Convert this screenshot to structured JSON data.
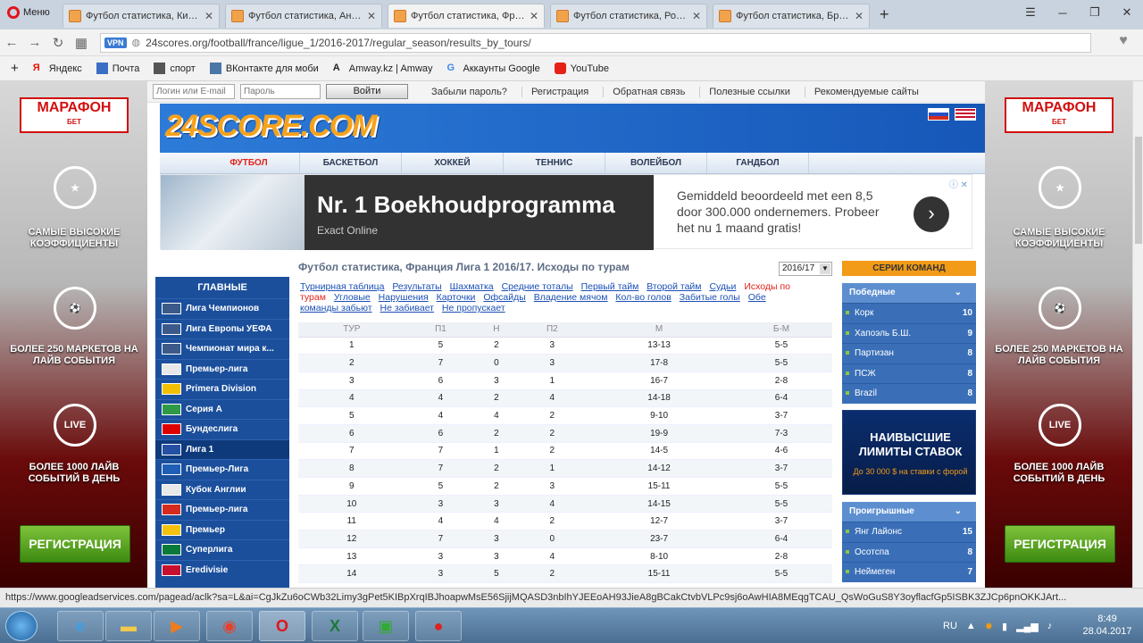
{
  "browser": {
    "menu_label": "Меню",
    "tabs": [
      {
        "title": "Футбол статистика, Китай"
      },
      {
        "title": "Футбол статистика, Англи"
      },
      {
        "title": "Футбол статистика, Франц"
      },
      {
        "title": "Футбол статистика, Росси"
      },
      {
        "title": "Футбол статистика, Бразі"
      }
    ],
    "active_tab": 2,
    "vpn": "VPN",
    "url": "24scores.org/football/france/ligue_1/2016-2017/regular_season/results_by_tours/",
    "bookmarks": [
      {
        "label": "Яндекс",
        "icon": "yandex-icon",
        "color": "#e61400"
      },
      {
        "label": "Почта",
        "icon": "mail-icon",
        "color": "#3b6fc6"
      },
      {
        "label": "спорт",
        "icon": "folder-icon",
        "color": "#444"
      },
      {
        "label": "ВКонтакте для моби",
        "icon": "vk-icon",
        "color": "#4a76a8"
      },
      {
        "label": "Amway.kz | Amway",
        "icon": "amway-icon",
        "color": "#222"
      },
      {
        "label": "Аккаунты Google",
        "icon": "google-icon",
        "color": "#4285f4"
      },
      {
        "label": "YouTube",
        "icon": "youtube-icon",
        "color": "#e62117"
      }
    ]
  },
  "side_ads": {
    "logo": "МАРАФОН",
    "logo_sub": "БЕТ",
    "item1": "САМЫЕ ВЫСОКИЕ КОЭФФИЦИЕНТЫ",
    "item2": "БОЛЕЕ 250 МАРКЕТОВ НА ЛАЙВ СОБЫТИЯ",
    "item3": "БОЛЕЕ 1000 ЛАЙВ СОБЫТИЙ В ДЕНЬ",
    "live": "LIVE",
    "register": "РЕГИСТРАЦИЯ"
  },
  "login": {
    "login_placeholder": "Логин или E-mail",
    "password_placeholder": "Пароль",
    "button": "Войти",
    "links": [
      "Забыли пароль?",
      "Регистрация",
      "Обратная связь",
      "Полезные ссылки",
      "Рекомендуемые сайты"
    ]
  },
  "site": {
    "logo": "24SCORE.COM"
  },
  "sports": [
    "ФУТБОЛ",
    "БАСКЕТБОЛ",
    "ХОККЕЙ",
    "ТЕННИС",
    "ВОЛЕЙБОЛ",
    "ГАНДБОЛ"
  ],
  "ad": {
    "title": "Nr. 1 Boekhoudprogramma",
    "sub": "Exact Online",
    "text": "Gemiddeld beoordeeld met een 8,5 door 300.000 ondernemers. Probeer het nu 1 maand gratis!"
  },
  "left_menu": {
    "head": "ГЛАВНЫЕ",
    "items": [
      {
        "label": "Лига Чемпионов",
        "flag": "#3b5a8a"
      },
      {
        "label": "Лига Европы УЕФА",
        "flag": "#3b5a8a"
      },
      {
        "label": "Чемпионат мира к...",
        "flag": "#3b5a8a"
      },
      {
        "label": "Премьер-лига",
        "flag": "#e8e8e8"
      },
      {
        "label": "Primera Division",
        "flag": "#f1bf00"
      },
      {
        "label": "Серия А",
        "flag": "#2e9a47"
      },
      {
        "label": "Бундеслига",
        "flag": "#dd0000"
      },
      {
        "label": "Лига 1",
        "flag": "#2550a4"
      },
      {
        "label": "Премьер-Лига",
        "flag": "#1f5fb5"
      },
      {
        "label": "Кубок Англии",
        "flag": "#e8e8e8"
      },
      {
        "label": "Премьер-лига",
        "flag": "#d52b1e"
      },
      {
        "label": "Премьер",
        "flag": "#f4c20d"
      },
      {
        "label": "Суперлига",
        "flag": "#0a7a3a"
      },
      {
        "label": "Eredivisie",
        "flag": "#c8102e"
      }
    ],
    "active": 7
  },
  "main": {
    "title": "Футбол статистика, Франция Лига 1 2016/17. Исходы по турам",
    "season": "2016/17",
    "links": [
      "Турнирная таблица",
      "Результаты",
      "Шахматка",
      "Средние тоталы",
      "Первый тайм",
      "Второй тайм",
      "Судьи",
      "Исходы по турам",
      "Угловые",
      "Нарушения",
      "Карточки",
      "Офсайды",
      "Владение мячом",
      "Кол-во голов",
      "Забитые голы",
      "Обе команды забьют",
      "Не забивает",
      "Не пропускает"
    ],
    "current_link": 7,
    "columns": [
      "ТУР",
      "П1",
      "Н",
      "П2",
      "М",
      "Б-М"
    ],
    "rows": [
      [
        "1",
        "5",
        "2",
        "3",
        "13-13",
        "5-5"
      ],
      [
        "2",
        "7",
        "0",
        "3",
        "17-8",
        "5-5"
      ],
      [
        "3",
        "6",
        "3",
        "1",
        "16-7",
        "2-8"
      ],
      [
        "4",
        "4",
        "2",
        "4",
        "14-18",
        "6-4"
      ],
      [
        "5",
        "4",
        "4",
        "2",
        "9-10",
        "3-7"
      ],
      [
        "6",
        "6",
        "2",
        "2",
        "19-9",
        "7-3"
      ],
      [
        "7",
        "7",
        "1",
        "2",
        "14-5",
        "4-6"
      ],
      [
        "8",
        "7",
        "2",
        "1",
        "14-12",
        "3-7"
      ],
      [
        "9",
        "5",
        "2",
        "3",
        "15-11",
        "5-5"
      ],
      [
        "10",
        "3",
        "3",
        "4",
        "14-15",
        "5-5"
      ],
      [
        "11",
        "4",
        "4",
        "2",
        "12-7",
        "3-7"
      ],
      [
        "12",
        "7",
        "3",
        "0",
        "23-7",
        "6-4"
      ],
      [
        "13",
        "3",
        "3",
        "4",
        "8-10",
        "2-8"
      ],
      [
        "14",
        "3",
        "5",
        "2",
        "15-11",
        "5-5"
      ]
    ]
  },
  "right": {
    "series": "СЕРИИ КОМАНД",
    "winners_head": "Победные",
    "winners": [
      [
        "Корк",
        "10"
      ],
      [
        "Хапоэль Б.Ш.",
        "9"
      ],
      [
        "Партизан",
        "8"
      ],
      [
        "ПСЖ",
        "8"
      ],
      [
        "Brazil",
        "8"
      ]
    ],
    "ad_title": "НАИВЫСШИЕ ЛИМИТЫ СТАВОК",
    "ad_sub": "До 30 000 $ на ставки с форой",
    "losers_head": "Проигрышные",
    "losers": [
      [
        "Янг Лайонс",
        "15"
      ],
      [
        "Осотспа",
        "8"
      ],
      [
        "Неймеген",
        "7"
      ]
    ]
  },
  "status_url": "https://www.googleadservices.com/pagead/aclk?sa=L&ai=CgJkZu6oCWb32Limy3gPet5KIBpXrqIBJhoapwMsE56SjijMQASD3nbIhYJEEoAH93JieA8gBCakCtvbVLPc9sj6oAwHIA8MEqgTCAU_QsWoGuS8Y3oyflacfGp5ISBK3ZJCp6pnOKKJArt...",
  "taskbar": {
    "lang": "RU",
    "time": "8:49",
    "date": "28.04.2017"
  }
}
